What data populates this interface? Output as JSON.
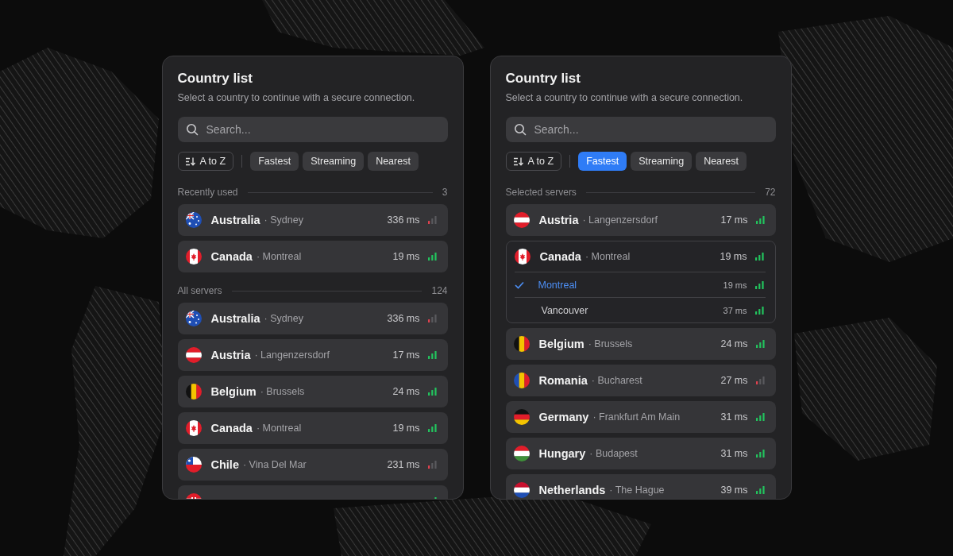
{
  "panels": [
    {
      "title": "Country list",
      "subtitle": "Select a country to continue with a secure connection.",
      "search": {
        "placeholder": "Search..."
      },
      "sort": {
        "label": "A to Z"
      },
      "filters": [
        {
          "label": "Fastest",
          "selected": false
        },
        {
          "label": "Streaming",
          "selected": false
        },
        {
          "label": "Nearest",
          "selected": false
        }
      ],
      "sections": [
        {
          "title": "Recently used",
          "count": "3",
          "rows": [
            {
              "flag": {
                "kind": "au"
              },
              "country": "Australia",
              "city": "· Sydney",
              "latency": "336 ms",
              "weak_signal": true,
              "expanded": false
            },
            {
              "flag": {
                "kind": "ca"
              },
              "country": "Canada",
              "city": "· Montreal",
              "latency": "19 ms",
              "weak_signal": false,
              "expanded": false
            }
          ]
        },
        {
          "title": "All servers",
          "count": "124",
          "rows": [
            {
              "flag": {
                "kind": "au"
              },
              "country": "Australia",
              "city": "· Sydney",
              "latency": "336 ms",
              "weak_signal": true,
              "expanded": false
            },
            {
              "flag": {
                "kind": "at"
              },
              "country": "Austria",
              "city": "· Langenzersdorf",
              "latency": "17 ms",
              "weak_signal": false,
              "expanded": false
            },
            {
              "flag": {
                "kind": "be"
              },
              "country": "Belgium",
              "city": "· Brussels",
              "latency": "24 ms",
              "weak_signal": false,
              "expanded": false
            },
            {
              "flag": {
                "kind": "ca"
              },
              "country": "Canada",
              "city": "· Montreal",
              "latency": "19 ms",
              "weak_signal": false,
              "expanded": false
            },
            {
              "flag": {
                "kind": "cl"
              },
              "country": "Chile",
              "city": "· Vina Del Mar",
              "latency": "231 ms",
              "weak_signal": true,
              "expanded": false
            },
            {
              "flag": {
                "kind": "hr"
              },
              "weak_signal": false,
              "expanded": false
            }
          ]
        }
      ]
    },
    {
      "title": "Country list",
      "subtitle": "Select a country to continue with a secure connection.",
      "search": {
        "placeholder": "Search..."
      },
      "sort": {
        "label": "A to Z"
      },
      "filters": [
        {
          "label": "Fastest",
          "selected": true
        },
        {
          "label": "Streaming",
          "selected": false
        },
        {
          "label": "Nearest",
          "selected": false
        }
      ],
      "sections": [
        {
          "title": "Selected servers",
          "count": "72",
          "rows": [
            {
              "flag": {
                "kind": "at"
              },
              "country": "Austria",
              "city": "· Langenzersdorf",
              "latency": "17 ms",
              "weak_signal": false,
              "expanded": false
            },
            {
              "flag": {
                "kind": "ca"
              },
              "country": "Canada",
              "city": "· Montreal",
              "latency": "19 ms",
              "weak_signal": false,
              "expanded": true,
              "cities": [
                {
                  "name": "Montreal",
                  "latency": "19 ms",
                  "selected": true,
                  "weak_signal": false
                },
                {
                  "name": "Vancouver",
                  "latency": "37 ms",
                  "selected": false,
                  "weak_signal": false
                }
              ]
            },
            {
              "flag": {
                "kind": "be"
              },
              "country": "Belgium",
              "city": "· Brussels",
              "latency": "24 ms",
              "weak_signal": false,
              "expanded": false
            },
            {
              "flag": {
                "kind": "ro"
              },
              "country": "Romania",
              "city": "· Bucharest",
              "latency": "27 ms",
              "weak_signal": true,
              "expanded": false
            },
            {
              "flag": {
                "kind": "de"
              },
              "country": "Germany",
              "city": "· Frankfurt Am Main",
              "latency": "31 ms",
              "weak_signal": false,
              "expanded": false
            },
            {
              "flag": {
                "kind": "hu"
              },
              "country": "Hungary",
              "city": "· Budapest",
              "latency": "31 ms",
              "weak_signal": false,
              "expanded": false
            },
            {
              "flag": {
                "kind": "nl"
              },
              "country": "Netherlands",
              "city": "· The Hague",
              "latency": "39 ms",
              "weak_signal": false,
              "expanded": false
            }
          ]
        }
      ]
    }
  ]
}
